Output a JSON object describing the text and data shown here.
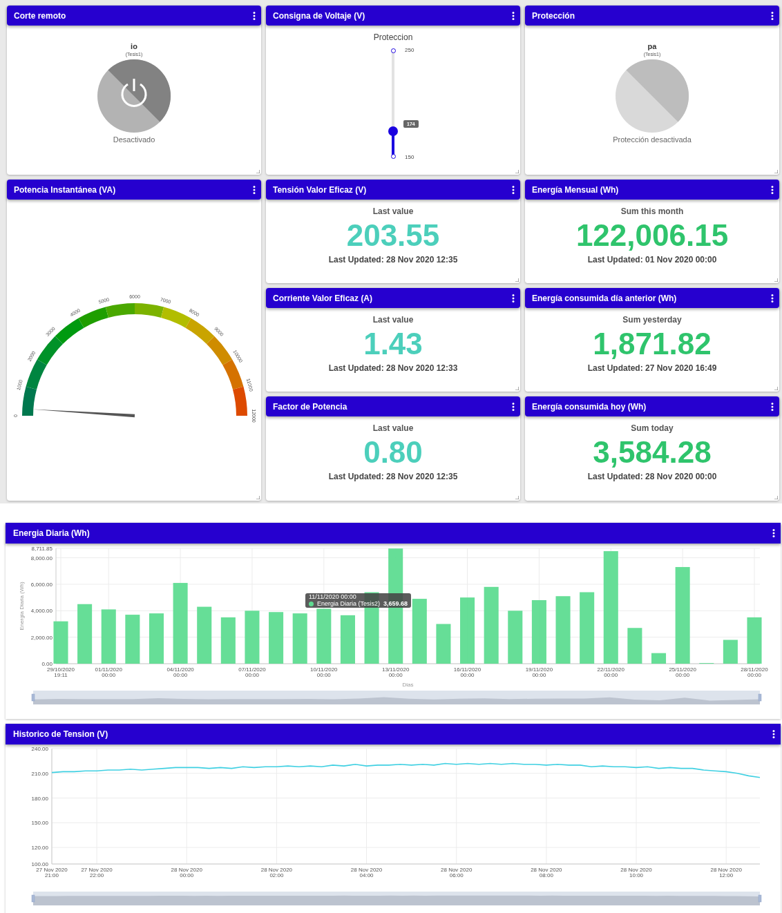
{
  "cards": [
    {
      "kind": "switch",
      "title": "Corte remoto",
      "name": "io",
      "device": "(Tesis1)",
      "status": "Desactivado",
      "on": false,
      "power_icon": true
    },
    {
      "kind": "slider",
      "title": "Consigna de Voltaje (V)",
      "label": "Proteccion",
      "max": "250",
      "min": "150",
      "value": "174"
    },
    {
      "kind": "switch",
      "title": "Protección",
      "name": "pa",
      "device": "(Tesis1)",
      "status": "Protección desactivada",
      "on": false,
      "power_icon": false
    },
    {
      "kind": "gauge",
      "title": "Potencia Instantánea (VA)",
      "ticks": [
        "0",
        "1000",
        "2000",
        "3000",
        "4000",
        "5000",
        "6000",
        "7000",
        "8000",
        "9000",
        "10000",
        "11000",
        "12000"
      ]
    },
    {
      "kind": "value",
      "title": "Tensión Valor Eficaz (V)",
      "caption": "Last value",
      "value": "203.55",
      "updated": "Last Updated: 28 Nov 2020 12:35",
      "color": "#4ccfbb"
    },
    {
      "kind": "value",
      "title": "Energía Mensual (Wh)",
      "caption": "Sum this month",
      "value": "122,006.15",
      "updated": "Last Updated: 01 Nov 2020 00:00",
      "color": "#2fc46c"
    },
    {
      "kind": "value",
      "title": "Corriente Valor Eficaz (A)",
      "caption": "Last value",
      "value": "1.43",
      "updated": "Last Updated: 28 Nov 2020 12:33",
      "color": "#4ccfbb"
    },
    {
      "kind": "value",
      "title": "Energía consumida día anterior (Wh)",
      "caption": "Sum yesterday",
      "value": "1,871.82",
      "updated": "Last Updated: 27 Nov 2020 16:49",
      "color": "#2fc46c"
    },
    {
      "kind": "value",
      "title": "Factor de Potencia",
      "caption": "Last value",
      "value": "0.80",
      "updated": "Last Updated: 28 Nov 2020 12:35",
      "color": "#4ccfbb"
    },
    {
      "kind": "value",
      "title": "Energía consumida hoy (Wh)",
      "caption": "Sum today",
      "value": "3,584.28",
      "updated": "Last Updated: 28 Nov 2020 00:00",
      "color": "#2fc46c"
    }
  ],
  "charts": [
    {
      "title": "Energia Diaria (Wh)",
      "tooltip": {
        "title": "11/11/2020 00:00",
        "value": "3,659.68"
      },
      "chart_data": {
        "type": "bar",
        "xlabel": "Dias",
        "ylabel": "Energia Diaria (Wh)",
        "grid": true,
        "categories": [
          "29/10/2020 19:11",
          null,
          "01/11/2020 00:00",
          null,
          null,
          "04/11/2020 00:00",
          null,
          null,
          "07/11/2020 00:00",
          null,
          null,
          "10/11/2020 00:00",
          null,
          null,
          "13/11/2020 00:00",
          null,
          null,
          "16/11/2020 00:00",
          null,
          null,
          "19/11/2020 00:00",
          null,
          null,
          "22/11/2020 00:00",
          null,
          null,
          "25/11/2020 00:00",
          null,
          null,
          "28/11/2020 00:00"
        ],
        "series": [
          {
            "name": "Energia Diaria (Tesis2)",
            "color": "#5edc91",
            "values": [
              3200,
              4500,
              4100,
              3700,
              3800,
              6100,
              4300,
              3500,
              4000,
              3900,
              3800,
              4150,
              3660,
              5400,
              8700,
              4900,
              3000,
              5000,
              5800,
              4000,
              4800,
              5100,
              5400,
              8500,
              2700,
              800,
              7300,
              50,
              1800,
              3500
            ]
          }
        ],
        "ylim": [
          0,
          8711.85
        ],
        "yticks": [
          {
            "value": 0,
            "label": "0.00"
          },
          {
            "value": 2000,
            "label": "2,000.00"
          },
          {
            "value": 4000,
            "label": "4,000.00"
          },
          {
            "value": 6000,
            "label": "6,000.00"
          },
          {
            "value": 8000,
            "label": "8,000.00"
          },
          {
            "value": 8711.85,
            "label": "8,711.85"
          }
        ]
      }
    },
    {
      "title": "Historico de Tension (V)",
      "chart_data": {
        "type": "line",
        "grid": true,
        "categories": [
          "27 Nov 2020 21:00",
          null,
          null,
          null,
          "27 Nov 2020 22:00",
          null,
          null,
          null,
          null,
          null,
          null,
          null,
          "28 Nov 2020 00:00",
          null,
          null,
          null,
          null,
          null,
          null,
          null,
          "28 Nov 2020 02:00",
          null,
          null,
          null,
          null,
          null,
          null,
          null,
          "28 Nov 2020 04:00",
          null,
          null,
          null,
          null,
          null,
          null,
          null,
          "28 Nov 2020 06:00",
          null,
          null,
          null,
          null,
          null,
          null,
          null,
          "28 Nov 2020 08:00",
          null,
          null,
          null,
          null,
          null,
          null,
          null,
          "28 Nov 2020 10:00",
          null,
          null,
          null,
          null,
          null,
          null,
          null,
          "28 Nov 2020 12:00",
          null,
          null,
          null
        ],
        "series": [
          {
            "color": "#3fd0e2",
            "values": [
              211,
              212,
              212,
              213,
              213,
              214,
              214,
              215,
              214,
              215,
              216,
              217,
              217,
              217,
              216,
              217,
              216,
              218,
              217,
              218,
              218,
              219,
              218,
              219,
              218,
              220,
              219,
              221,
              219,
              220,
              220,
              221,
              220,
              221,
              220,
              222,
              221,
              222,
              221,
              222,
              221,
              222,
              221,
              221,
              220,
              221,
              220,
              220,
              218,
              219,
              218,
              218,
              217,
              218,
              216,
              217,
              216,
              216,
              214,
              213,
              212,
              210,
              207,
              205
            ]
          }
        ],
        "ylim": [
          100,
          240
        ],
        "yticks": [
          {
            "value": 100,
            "label": "100.00"
          },
          {
            "value": 120,
            "label": "120.00"
          },
          {
            "value": 150,
            "label": "150.00"
          },
          {
            "value": 180,
            "label": "180.00"
          },
          {
            "value": 210,
            "label": "210.00"
          },
          {
            "value": 240,
            "label": "240.00"
          }
        ]
      }
    }
  ]
}
